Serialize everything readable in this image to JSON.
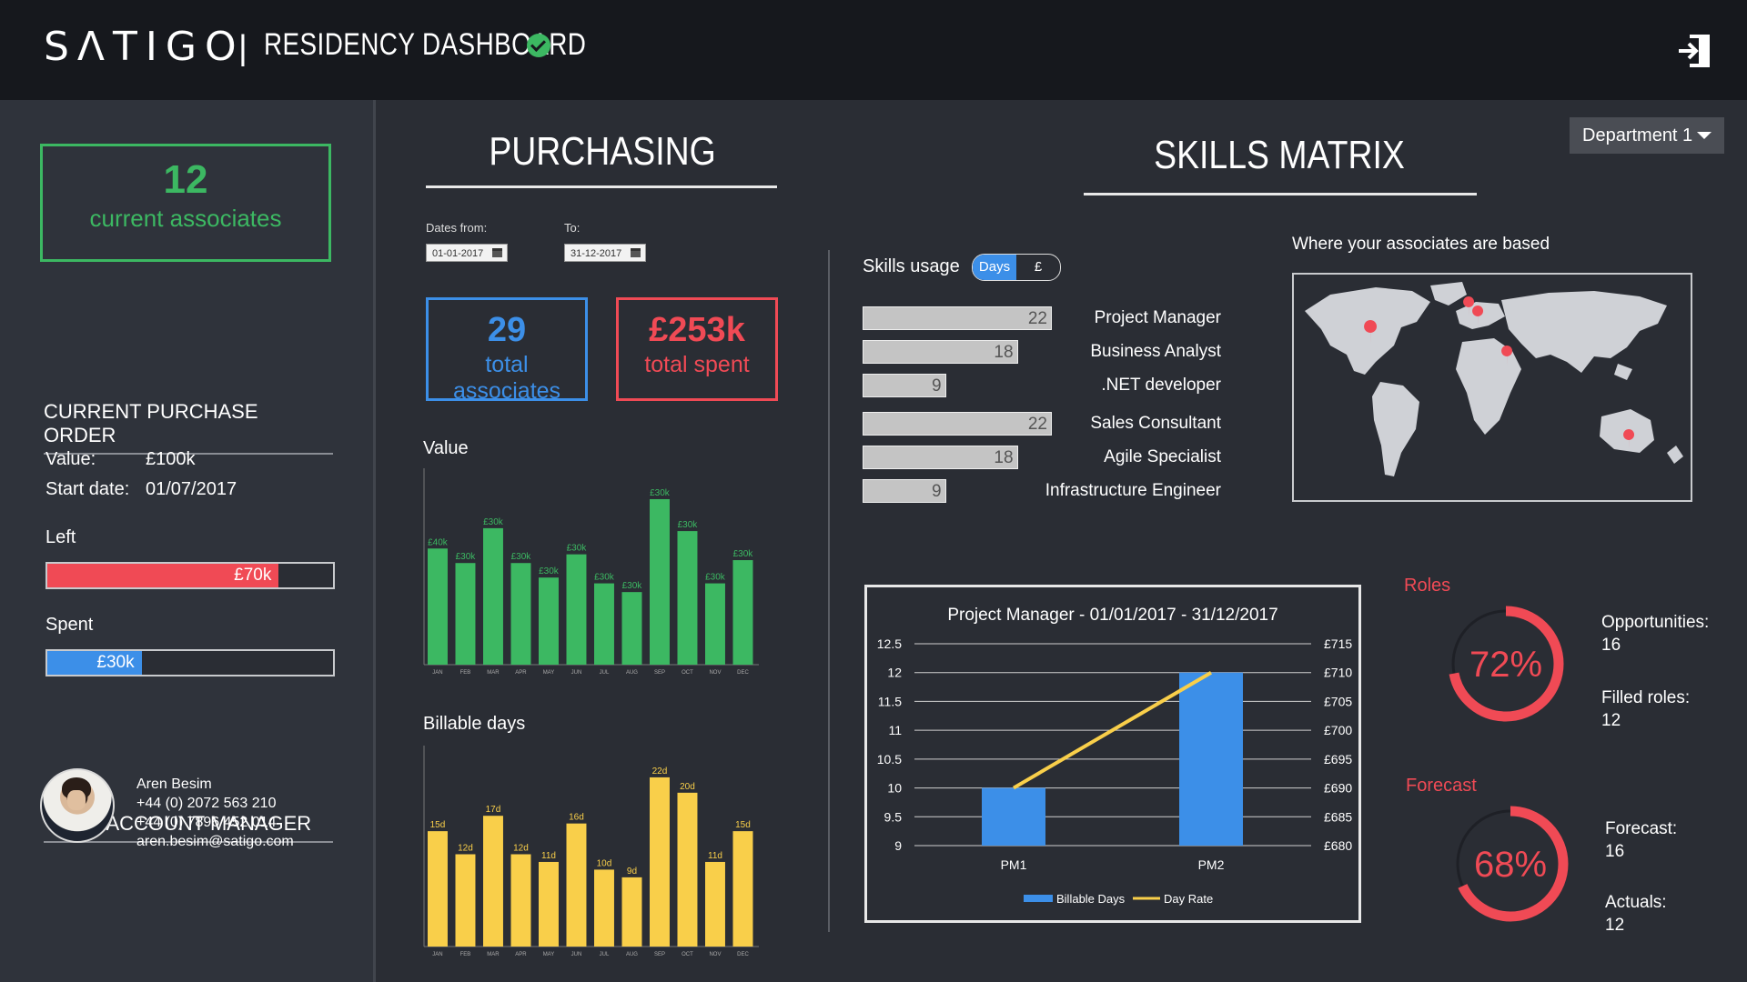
{
  "header": {
    "logo": "SΛTIGO",
    "separator": "|",
    "title": "RESIDENCY DASHBOARD"
  },
  "sidebar": {
    "associates": {
      "count": "12",
      "label": "current associates"
    },
    "purchase_order": {
      "heading": "CURRENT PURCHASE ORDER",
      "value_label": "Value:",
      "value": "£100k",
      "start_label": "Start date:",
      "start": "01/07/2017",
      "left_label": "Left",
      "left_value": "£70k",
      "left_fraction": 0.81,
      "spent_label": "Spent",
      "spent_value": "£30k",
      "spent_fraction": 0.33
    },
    "account_manager": {
      "heading": "YOUR ACCOUNT MANAGER",
      "name": "Aren Besim",
      "phone1": "+44 (0) 2072 563 210",
      "phone2": "+44 (0) 7896 452 014",
      "email": "aren.besim@satigo.com"
    }
  },
  "purchasing": {
    "title": "PURCHASING",
    "dates_from_label": "Dates from:",
    "dates_from": "01-01-2017",
    "to_label": "To:",
    "to": "31-12-2017",
    "total_associates": "29",
    "total_associates_label": "total associates",
    "total_spent": "£253k",
    "total_spent_label": "total spent",
    "value_chart_title": "Value",
    "billable_chart_title": "Billable days"
  },
  "skills": {
    "title": "SKILLS MATRIX",
    "usage_label": "Skills usage",
    "toggle_days": "Days",
    "toggle_pound": "£",
    "department": "Department 1",
    "map_title": "Where your associates are based",
    "rows": [
      {
        "name": "Project Manager",
        "value": "22",
        "frac": 1.0
      },
      {
        "name": "Business Analyst",
        "value": "18",
        "frac": 0.82
      },
      {
        "name": ".NET developer",
        "value": "9",
        "frac": 0.44
      },
      {
        "name": "Sales Consultant",
        "value": "22",
        "frac": 1.0
      },
      {
        "name": "Agile Specialist",
        "value": "18",
        "frac": 0.82
      },
      {
        "name": "Infrastructure Engineer",
        "value": "9",
        "frac": 0.44
      }
    ]
  },
  "roles": {
    "label": "Roles",
    "percent": "72%",
    "fraction": 0.72,
    "opp_label": "Opportunities:",
    "opp": "16",
    "filled_label": "Filled roles:",
    "filled": "12"
  },
  "forecast": {
    "label": "Forecast",
    "percent": "68%",
    "fraction": 0.68,
    "fc_label": "Forecast:",
    "fc": "16",
    "act_label": "Actuals:",
    "act": "12"
  },
  "colors": {
    "green": "#3cb862",
    "blue": "#3c8fe8",
    "red": "#f04a55",
    "yellow": "#f9cf4a"
  },
  "chart_data": [
    {
      "type": "bar",
      "title": "Value",
      "categories": [
        "JAN",
        "FEB",
        "MAR",
        "APR",
        "MAY",
        "JUN",
        "JUL",
        "AUG",
        "SEP",
        "OCT",
        "NOV",
        "DEC"
      ],
      "values": [
        40,
        35,
        47,
        35,
        30,
        38,
        28,
        25,
        57,
        46,
        28,
        36
      ],
      "labels": [
        "£40k",
        "£30k",
        "£30k",
        "£30k",
        "£30k",
        "£30k",
        "£30k",
        "£30k",
        "£30k",
        "£30k",
        "£30k",
        "£30k"
      ],
      "color": "#3cb862",
      "ylim": [
        0,
        62
      ]
    },
    {
      "type": "bar",
      "title": "Billable days",
      "categories": [
        "JAN",
        "FEB",
        "MAR",
        "APR",
        "MAY",
        "JUN",
        "JUL",
        "AUG",
        "SEP",
        "OCT",
        "NOV",
        "DEC"
      ],
      "values": [
        15,
        12,
        17,
        12,
        11,
        16,
        10,
        9,
        22,
        20,
        11,
        15
      ],
      "labels": [
        "15d",
        "12d",
        "17d",
        "12d",
        "11d",
        "16d",
        "10d",
        "9d",
        "22d",
        "20d",
        "11d",
        "15d"
      ],
      "color": "#f9cf4a",
      "ylim": [
        0,
        24
      ]
    },
    {
      "type": "bar",
      "title": "Project Manager - 01/01/2017 - 31/12/2017",
      "categories": [
        "PM1",
        "PM2"
      ],
      "series": [
        {
          "name": "Billable Days",
          "type": "bar",
          "values": [
            10,
            12
          ],
          "color": "#3c8fe8"
        },
        {
          "name": "Day Rate",
          "type": "line",
          "values": [
            690,
            710
          ],
          "color": "#f9cf4a"
        }
      ],
      "y_left": {
        "ticks": [
          9,
          9.5,
          10,
          10.5,
          11,
          11.5,
          12,
          12.5
        ],
        "labels": [
          "9",
          "9.5",
          "10",
          "10.5",
          "11",
          "11.5",
          "12",
          "12.5"
        ],
        "ylim": [
          9,
          12.5
        ]
      },
      "y_right": {
        "ticks": [
          680,
          685,
          690,
          695,
          700,
          705,
          710,
          715
        ],
        "labels": [
          "£680",
          "£685",
          "£690",
          "£695",
          "£700",
          "£705",
          "£710",
          "£715"
        ],
        "ylim": [
          680,
          715
        ]
      },
      "legend": "bottom"
    }
  ]
}
